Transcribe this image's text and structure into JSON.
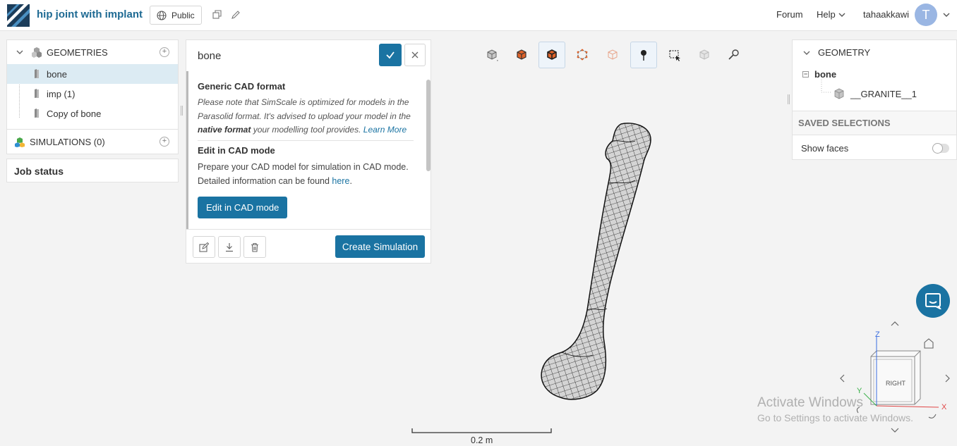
{
  "header": {
    "project_title": "hip joint with implant",
    "visibility_label": "Public",
    "forum_label": "Forum",
    "help_label": "Help",
    "username": "tahaakkawi",
    "avatar_initial": "T"
  },
  "left_panel": {
    "geometries_label": "GEOMETRIES",
    "geometry_items": [
      "bone",
      "imp (1)",
      "Copy of bone"
    ],
    "simulations_label": "SIMULATIONS (0)",
    "job_status_label": "Job status"
  },
  "detail_panel": {
    "title": "bone",
    "cad_heading": "Generic CAD format",
    "cad_note_1": "Please note that SimScale is optimized for models in the Parasolid format. It's advised to upload your model in the ",
    "cad_note_bold": "native format",
    "cad_note_2": " your modelling tool provides. ",
    "learn_more": "Learn More",
    "edit_heading": "Edit in CAD mode",
    "edit_text": "Prepare your CAD model for simulation in CAD mode. Detailed information can be found ",
    "edit_link": "here",
    "edit_period": ".",
    "edit_button": "Edit in CAD mode",
    "create_button": "Create Simulation"
  },
  "right_panel": {
    "geometry_label": "GEOMETRY",
    "bone_label": "bone",
    "granite_label": "__GRANITE__1",
    "saved_selections_label": "SAVED SELECTIONS",
    "show_faces_label": "Show faces",
    "show_faces_on": false
  },
  "viewer": {
    "scale_label": "0.2 m",
    "cube_face_label": "RIGHT",
    "axis_z": "Z",
    "axis_y": "Y",
    "axis_x": "X"
  },
  "watermark": {
    "line1": "Activate Windows",
    "line2": "Go to Settings to activate Windows."
  },
  "colors": {
    "accent": "#1a73a2",
    "selected_row": "#dcebf3",
    "avatar": "#9ab6e3"
  },
  "icons": [
    "globe-icon",
    "copy-icon",
    "pencil-icon",
    "chevron-down-icon",
    "plus-icon",
    "check-icon",
    "close-icon",
    "edit-icon",
    "download-icon",
    "trash-icon",
    "chat-icon",
    "home-icon"
  ]
}
